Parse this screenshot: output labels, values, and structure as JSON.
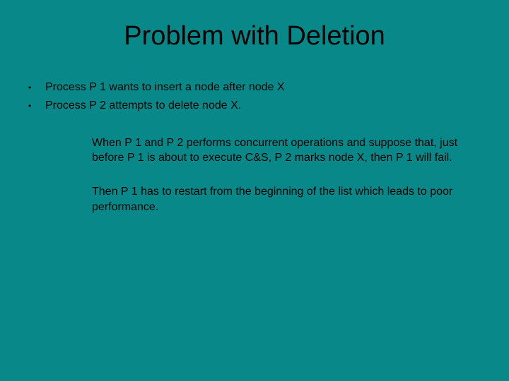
{
  "title": "Problem with Deletion",
  "bullets": [
    "Process P 1 wants to insert a node after node X",
    "Process P 2 attempts to delete node X."
  ],
  "paragraphs": [
    "When P 1 and P 2 performs concurrent operations and suppose that, just before P 1 is about to execute C&S, P 2 marks node X, then P 1 will fail.",
    "Then P 1 has to restart  from the beginning of the list which leads to poor performance."
  ]
}
